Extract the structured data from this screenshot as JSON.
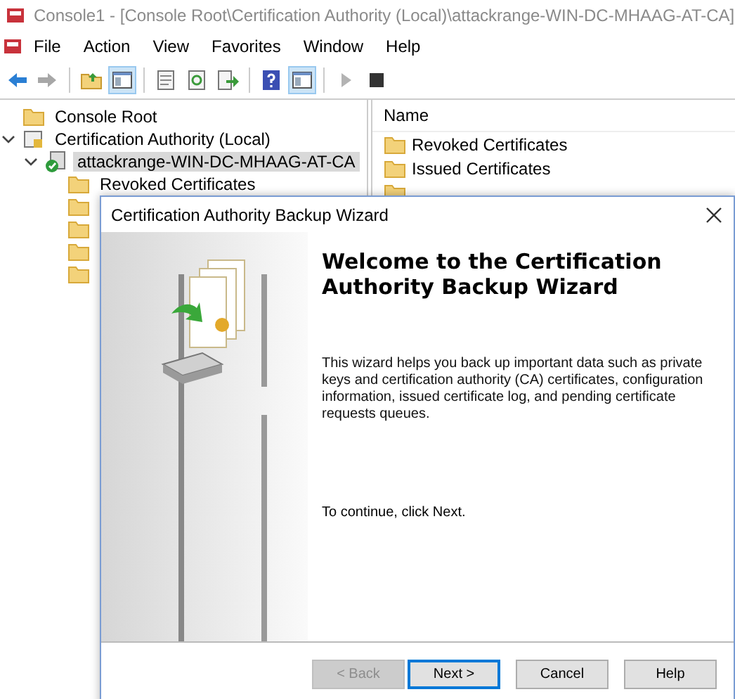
{
  "window": {
    "title": "Console1 - [Console Root\\Certification Authority (Local)\\attackrange-WIN-DC-MHAAG-AT-CA]"
  },
  "menu": [
    {
      "label": "File"
    },
    {
      "label": "Action"
    },
    {
      "label": "View"
    },
    {
      "label": "Favorites"
    },
    {
      "label": "Window"
    },
    {
      "label": "Help"
    }
  ],
  "toolbar": [
    {
      "kind": "back",
      "pressed": false,
      "disabled": false
    },
    {
      "kind": "forward",
      "pressed": false,
      "disabled": true
    },
    {
      "kind": "sep"
    },
    {
      "kind": "up",
      "pressed": false,
      "disabled": false
    },
    {
      "kind": "tree",
      "pressed": true,
      "disabled": false
    },
    {
      "kind": "sep"
    },
    {
      "kind": "properties",
      "pressed": false,
      "disabled": false
    },
    {
      "kind": "refresh",
      "pressed": false,
      "disabled": false
    },
    {
      "kind": "export",
      "pressed": false,
      "disabled": false
    },
    {
      "kind": "sep"
    },
    {
      "kind": "help",
      "pressed": false,
      "disabled": false
    },
    {
      "kind": "actionpane",
      "pressed": true,
      "disabled": false
    },
    {
      "kind": "sep"
    },
    {
      "kind": "play",
      "pressed": false,
      "disabled": true
    },
    {
      "kind": "stop",
      "pressed": false,
      "disabled": false
    }
  ],
  "tree": [
    {
      "label": "Console Root",
      "kind": "folder",
      "selected": false,
      "children": [
        {
          "label": "Certification Authority (Local)",
          "kind": "snapin",
          "expanded": true,
          "selected": false,
          "children": [
            {
              "label": "attackrange-WIN-DC-MHAAG-AT-CA",
              "kind": "ca",
              "expanded": true,
              "selected": true,
              "children": [
                {
                  "label": "Revoked Certificates",
                  "kind": "folder",
                  "selected": false
                },
                {
                  "kind": "folder",
                  "selected": false
                },
                {
                  "kind": "folder",
                  "selected": false
                },
                {
                  "kind": "folder",
                  "selected": false
                },
                {
                  "kind": "folder",
                  "selected": false
                }
              ]
            }
          ]
        }
      ]
    }
  ],
  "list": {
    "columns": [
      "Name"
    ],
    "rows": [
      {
        "label": "Revoked Certificates"
      },
      {
        "label": "Issued Certificates"
      },
      {}
    ]
  },
  "dialog": {
    "title": "Certification Authority Backup Wizard",
    "heading": "Welcome to the Certification Authority Backup Wizard",
    "body": "This wizard helps you back up important data such as private keys and certification authority (CA) certificates, configuration information, issued certificate log, and pending certificate requests queues.",
    "hint": "To continue, click Next.",
    "buttons": [
      {
        "label": "< Back",
        "disabled": true,
        "default": false
      },
      {
        "label": "Next >",
        "disabled": false,
        "default": true
      },
      {
        "label": "Cancel",
        "disabled": false,
        "default": false
      },
      {
        "label": "Help",
        "disabled": false,
        "default": false
      }
    ]
  }
}
